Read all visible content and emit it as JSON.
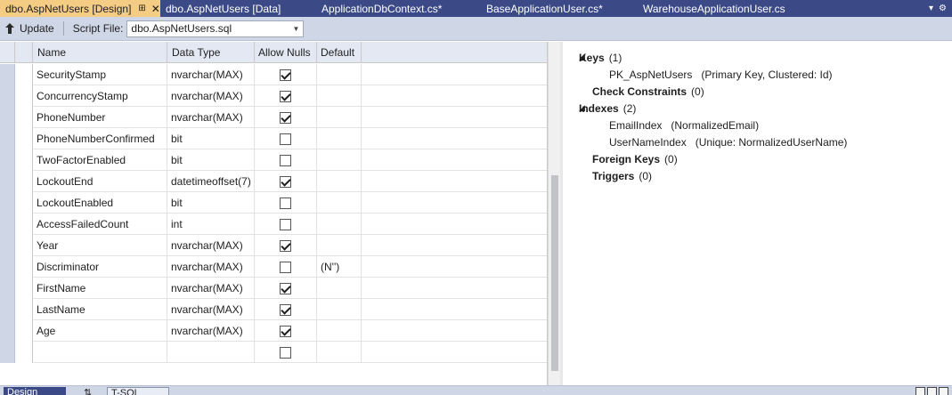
{
  "tabs": [
    {
      "label": "dbo.AspNetUsers [Design]",
      "active": true
    },
    {
      "label": "dbo.AspNetUsers [Data]",
      "active": false
    },
    {
      "label": "ApplicationDbContext.cs*",
      "active": false
    },
    {
      "label": "BaseApplicationUser.cs*",
      "active": false
    },
    {
      "label": "WarehouseApplicationUser.cs",
      "active": false
    }
  ],
  "toolbar": {
    "update_label": "Update",
    "script_file_label": "Script File:",
    "script_file_value": "dbo.AspNetUsers.sql"
  },
  "grid": {
    "headers": [
      "Name",
      "Data Type",
      "Allow Nulls",
      "Default"
    ],
    "rows": [
      {
        "name": "SecurityStamp",
        "type": "nvarchar(MAX)",
        "nulls": true,
        "default": ""
      },
      {
        "name": "ConcurrencyStamp",
        "type": "nvarchar(MAX)",
        "nulls": true,
        "default": ""
      },
      {
        "name": "PhoneNumber",
        "type": "nvarchar(MAX)",
        "nulls": true,
        "default": ""
      },
      {
        "name": "PhoneNumberConfirmed",
        "type": "bit",
        "nulls": false,
        "default": ""
      },
      {
        "name": "TwoFactorEnabled",
        "type": "bit",
        "nulls": false,
        "default": ""
      },
      {
        "name": "LockoutEnd",
        "type": "datetimeoffset(7)",
        "nulls": true,
        "default": ""
      },
      {
        "name": "LockoutEnabled",
        "type": "bit",
        "nulls": false,
        "default": ""
      },
      {
        "name": "AccessFailedCount",
        "type": "int",
        "nulls": false,
        "default": ""
      },
      {
        "name": "Year",
        "type": "nvarchar(MAX)",
        "nulls": true,
        "default": ""
      },
      {
        "name": "Discriminator",
        "type": "nvarchar(MAX)",
        "nulls": false,
        "default": "(N'')"
      },
      {
        "name": "FirstName",
        "type": "nvarchar(MAX)",
        "nulls": true,
        "default": ""
      },
      {
        "name": "LastName",
        "type": "nvarchar(MAX)",
        "nulls": true,
        "default": ""
      },
      {
        "name": "Age",
        "type": "nvarchar(MAX)",
        "nulls": true,
        "default": ""
      },
      {
        "name": "",
        "type": "",
        "nulls": false,
        "default": ""
      }
    ]
  },
  "properties": {
    "keys": {
      "label": "Keys",
      "count": "(1)",
      "items": [
        {
          "name": "PK_AspNetUsers",
          "detail": "(Primary Key, Clustered: Id)"
        }
      ]
    },
    "check_constraints": {
      "label": "Check Constraints",
      "count": "(0)"
    },
    "indexes": {
      "label": "Indexes",
      "count": "(2)",
      "items": [
        {
          "name": "EmailIndex",
          "detail": "(NormalizedEmail)"
        },
        {
          "name": "UserNameIndex",
          "detail": "(Unique: NormalizedUserName)"
        }
      ]
    },
    "foreign_keys": {
      "label": "Foreign Keys",
      "count": "(0)"
    },
    "triggers": {
      "label": "Triggers",
      "count": "(0)"
    }
  },
  "bottom": {
    "design_tab": "Design",
    "swap_glyph": "⇅",
    "tsql_tab": "T-SQL"
  }
}
